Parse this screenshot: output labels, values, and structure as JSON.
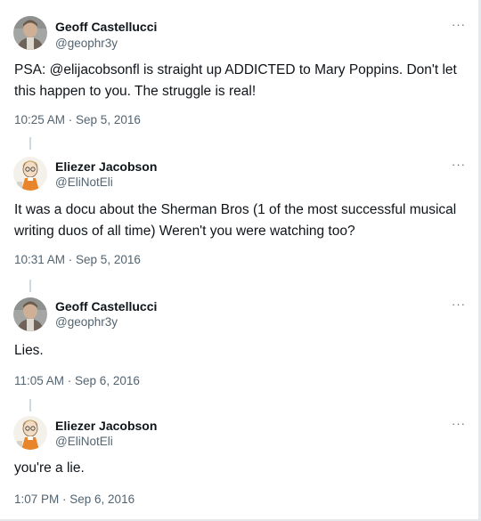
{
  "tweets": [
    {
      "author": "Geoff Castellucci",
      "handle": "@geophr3y",
      "text": "PSA: @elijacobsonfl is straight up ADDICTED to Mary Poppins. Don't let this happen to you. The struggle is real!",
      "timestamp": "10:25 AM · Sep 5, 2016",
      "avatar": "photo-avatar-geoff",
      "more_icon": "···"
    },
    {
      "author": "Eliezer Jacobson",
      "handle": "@EliNotEli",
      "text": "It was a docu about the Sherman Bros (1 of the most successful musical writing duos of all time) Weren't you were watching too?",
      "timestamp": "10:31 AM · Sep 5, 2016",
      "avatar": "cartoon-avatar-eliezer",
      "more_icon": "···"
    },
    {
      "author": "Geoff Castellucci",
      "handle": "@geophr3y",
      "text": "Lies.",
      "timestamp": "11:05 AM · Sep 6, 2016",
      "avatar": "photo-avatar-geoff",
      "more_icon": "···"
    },
    {
      "author": "Eliezer Jacobson",
      "handle": "@EliNotEli",
      "text": "you're a lie.",
      "timestamp": "1:07 PM · Sep 6, 2016",
      "avatar": "cartoon-avatar-eliezer",
      "more_icon": "···"
    }
  ],
  "colors": {
    "primary_text": "#0f1419",
    "secondary_text": "#536471",
    "connector": "#cfd9de"
  }
}
